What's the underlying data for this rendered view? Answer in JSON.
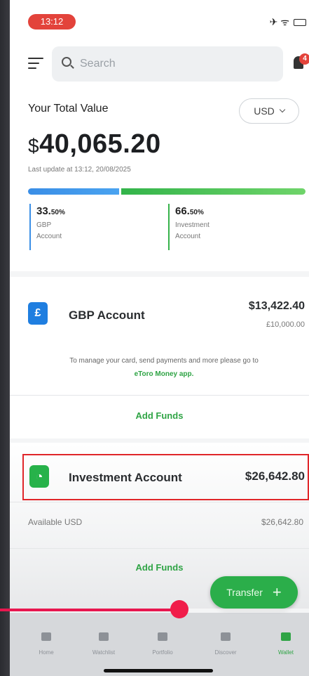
{
  "status_bar": {
    "time": "13:12",
    "icons": "✈ ᯤ"
  },
  "header": {
    "search_placeholder": "Search",
    "notification_count": "4"
  },
  "total_value": {
    "label": "Your Total Value",
    "currency_selected": "USD",
    "currency_symbol": "$",
    "amount": "40,065.20",
    "last_update": "Last update at 13:12, 20/08/2025",
    "allocation": [
      {
        "key": "gbp",
        "percent_main": "33.",
        "percent_small": "50%",
        "fraction": 0.335,
        "label_line1": "GBP",
        "label_line2": "Account",
        "color": "#3a8ee6"
      },
      {
        "key": "inv",
        "percent_main": "66.",
        "percent_small": "50%",
        "fraction": 0.665,
        "label_line1": "Investment",
        "label_line2": "Account",
        "color": "#36b24b"
      }
    ]
  },
  "gbp_account": {
    "icon_glyph": "£",
    "name": "GBP Account",
    "value_usd": "$13,422.40",
    "value_local": "£10,000.00",
    "note_text": "To manage your card, send payments and more please go to",
    "note_link": "eToro Money app.",
    "add_funds": "Add Funds"
  },
  "investment_account": {
    "icon_glyph": "◔",
    "name": "Investment Account",
    "value_usd": "$26,642.80",
    "available_label": "Available USD",
    "available_value": "$26,642.80",
    "add_funds": "Add Funds"
  },
  "transfer_button": {
    "label": "Transfer",
    "plus": "+"
  },
  "tabs": [
    {
      "label": "Home",
      "active": false
    },
    {
      "label": "Watchlist",
      "active": false
    },
    {
      "label": "Portfolio",
      "active": false
    },
    {
      "label": "Discover",
      "active": false
    },
    {
      "label": "Wallet",
      "active": true
    }
  ],
  "video_scrubber": {
    "progress": 0.58,
    "fill_color": "#e8174f"
  }
}
